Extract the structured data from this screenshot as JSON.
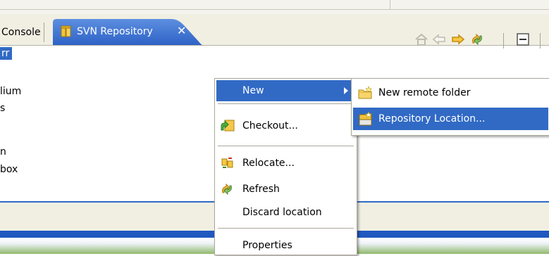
{
  "tabs": {
    "console_label": "Console",
    "active_label": "SVN Repository",
    "close_symbol": "✕"
  },
  "toolbar": {
    "icons": [
      "home-icon",
      "back-icon",
      "forward-icon",
      "refresh-icon",
      "collapse-all-icon"
    ]
  },
  "tree": {
    "selected_label": "rr",
    "items": [
      "lium",
      "s",
      "n",
      "box"
    ]
  },
  "context_menu": {
    "new_label": "New",
    "checkout_label": "Checkout...",
    "relocate_label": "Relocate...",
    "refresh_label": "Refresh",
    "discard_label": "Discard location",
    "properties_label": "Properties"
  },
  "submenu": {
    "new_remote_folder_label": "New remote folder",
    "repository_location_label": "Repository Location..."
  },
  "colors": {
    "highlight": "#316ac5",
    "tab_active": "#3a6fd0",
    "panel": "#f1efe2"
  }
}
